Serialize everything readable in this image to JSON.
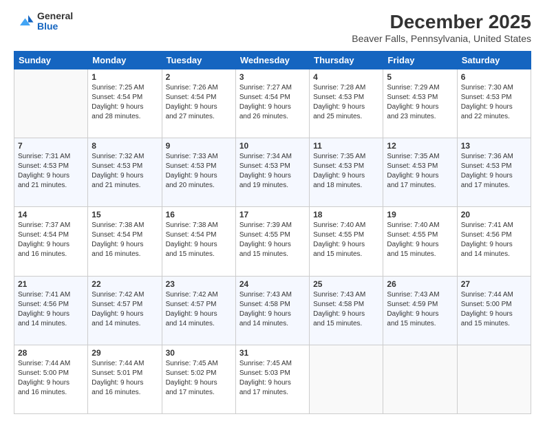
{
  "logo": {
    "general": "General",
    "blue": "Blue"
  },
  "header": {
    "title": "December 2025",
    "subtitle": "Beaver Falls, Pennsylvania, United States"
  },
  "days_of_week": [
    "Sunday",
    "Monday",
    "Tuesday",
    "Wednesday",
    "Thursday",
    "Friday",
    "Saturday"
  ],
  "weeks": [
    [
      {
        "num": "",
        "info": ""
      },
      {
        "num": "1",
        "info": "Sunrise: 7:25 AM\nSunset: 4:54 PM\nDaylight: 9 hours\nand 28 minutes."
      },
      {
        "num": "2",
        "info": "Sunrise: 7:26 AM\nSunset: 4:54 PM\nDaylight: 9 hours\nand 27 minutes."
      },
      {
        "num": "3",
        "info": "Sunrise: 7:27 AM\nSunset: 4:54 PM\nDaylight: 9 hours\nand 26 minutes."
      },
      {
        "num": "4",
        "info": "Sunrise: 7:28 AM\nSunset: 4:53 PM\nDaylight: 9 hours\nand 25 minutes."
      },
      {
        "num": "5",
        "info": "Sunrise: 7:29 AM\nSunset: 4:53 PM\nDaylight: 9 hours\nand 23 minutes."
      },
      {
        "num": "6",
        "info": "Sunrise: 7:30 AM\nSunset: 4:53 PM\nDaylight: 9 hours\nand 22 minutes."
      }
    ],
    [
      {
        "num": "7",
        "info": "Sunrise: 7:31 AM\nSunset: 4:53 PM\nDaylight: 9 hours\nand 21 minutes."
      },
      {
        "num": "8",
        "info": "Sunrise: 7:32 AM\nSunset: 4:53 PM\nDaylight: 9 hours\nand 21 minutes."
      },
      {
        "num": "9",
        "info": "Sunrise: 7:33 AM\nSunset: 4:53 PM\nDaylight: 9 hours\nand 20 minutes."
      },
      {
        "num": "10",
        "info": "Sunrise: 7:34 AM\nSunset: 4:53 PM\nDaylight: 9 hours\nand 19 minutes."
      },
      {
        "num": "11",
        "info": "Sunrise: 7:35 AM\nSunset: 4:53 PM\nDaylight: 9 hours\nand 18 minutes."
      },
      {
        "num": "12",
        "info": "Sunrise: 7:35 AM\nSunset: 4:53 PM\nDaylight: 9 hours\nand 17 minutes."
      },
      {
        "num": "13",
        "info": "Sunrise: 7:36 AM\nSunset: 4:53 PM\nDaylight: 9 hours\nand 17 minutes."
      }
    ],
    [
      {
        "num": "14",
        "info": "Sunrise: 7:37 AM\nSunset: 4:54 PM\nDaylight: 9 hours\nand 16 minutes."
      },
      {
        "num": "15",
        "info": "Sunrise: 7:38 AM\nSunset: 4:54 PM\nDaylight: 9 hours\nand 16 minutes."
      },
      {
        "num": "16",
        "info": "Sunrise: 7:38 AM\nSunset: 4:54 PM\nDaylight: 9 hours\nand 15 minutes."
      },
      {
        "num": "17",
        "info": "Sunrise: 7:39 AM\nSunset: 4:55 PM\nDaylight: 9 hours\nand 15 minutes."
      },
      {
        "num": "18",
        "info": "Sunrise: 7:40 AM\nSunset: 4:55 PM\nDaylight: 9 hours\nand 15 minutes."
      },
      {
        "num": "19",
        "info": "Sunrise: 7:40 AM\nSunset: 4:55 PM\nDaylight: 9 hours\nand 15 minutes."
      },
      {
        "num": "20",
        "info": "Sunrise: 7:41 AM\nSunset: 4:56 PM\nDaylight: 9 hours\nand 14 minutes."
      }
    ],
    [
      {
        "num": "21",
        "info": "Sunrise: 7:41 AM\nSunset: 4:56 PM\nDaylight: 9 hours\nand 14 minutes."
      },
      {
        "num": "22",
        "info": "Sunrise: 7:42 AM\nSunset: 4:57 PM\nDaylight: 9 hours\nand 14 minutes."
      },
      {
        "num": "23",
        "info": "Sunrise: 7:42 AM\nSunset: 4:57 PM\nDaylight: 9 hours\nand 14 minutes."
      },
      {
        "num": "24",
        "info": "Sunrise: 7:43 AM\nSunset: 4:58 PM\nDaylight: 9 hours\nand 14 minutes."
      },
      {
        "num": "25",
        "info": "Sunrise: 7:43 AM\nSunset: 4:58 PM\nDaylight: 9 hours\nand 15 minutes."
      },
      {
        "num": "26",
        "info": "Sunrise: 7:43 AM\nSunset: 4:59 PM\nDaylight: 9 hours\nand 15 minutes."
      },
      {
        "num": "27",
        "info": "Sunrise: 7:44 AM\nSunset: 5:00 PM\nDaylight: 9 hours\nand 15 minutes."
      }
    ],
    [
      {
        "num": "28",
        "info": "Sunrise: 7:44 AM\nSunset: 5:00 PM\nDaylight: 9 hours\nand 16 minutes."
      },
      {
        "num": "29",
        "info": "Sunrise: 7:44 AM\nSunset: 5:01 PM\nDaylight: 9 hours\nand 16 minutes."
      },
      {
        "num": "30",
        "info": "Sunrise: 7:45 AM\nSunset: 5:02 PM\nDaylight: 9 hours\nand 17 minutes."
      },
      {
        "num": "31",
        "info": "Sunrise: 7:45 AM\nSunset: 5:03 PM\nDaylight: 9 hours\nand 17 minutes."
      },
      {
        "num": "",
        "info": ""
      },
      {
        "num": "",
        "info": ""
      },
      {
        "num": "",
        "info": ""
      }
    ]
  ]
}
